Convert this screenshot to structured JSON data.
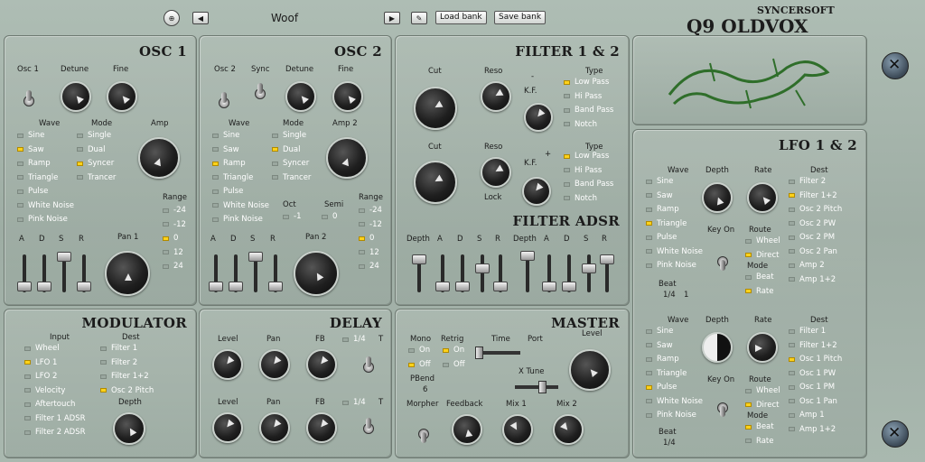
{
  "header": {
    "preset": "Woof",
    "load": "Load bank",
    "save": "Save bank",
    "brand": "SYNCERSOFT",
    "product": "Q9 OLDVOX"
  },
  "osc1": {
    "title": "OSC 1",
    "osc": "Osc 1",
    "detune": "Detune",
    "fine": "Fine",
    "wave": "Wave",
    "mode": "Mode",
    "amp": "Amp",
    "waves": [
      "Sine",
      "Saw",
      "Ramp",
      "Triangle",
      "Pulse",
      "White Noise",
      "Pink Noise"
    ],
    "wave_on": 1,
    "modes": [
      "Single",
      "Dual",
      "Syncer",
      "Trancer"
    ],
    "mode_on": 2,
    "range": "Range",
    "ranges": [
      "-24",
      "-12",
      "0",
      "12",
      "24"
    ],
    "range_on": 2,
    "adsr": [
      "A",
      "D",
      "S",
      "R"
    ],
    "pan": "Pan 1"
  },
  "osc2": {
    "title": "OSC 2",
    "osc": "Osc 2",
    "sync": "Sync",
    "detune": "Detune",
    "fine": "Fine",
    "wave": "Wave",
    "mode": "Mode",
    "amp": "Amp 2",
    "waves": [
      "Sine",
      "Saw",
      "Ramp",
      "Triangle",
      "Pulse",
      "White Noise",
      "Pink Noise"
    ],
    "wave_on": 2,
    "modes": [
      "Single",
      "Dual",
      "Syncer",
      "Trancer"
    ],
    "mode_on": 1,
    "oct": "Oct",
    "semi": "Semi",
    "oct_val": "-1",
    "semi_val": "0",
    "range": "Range",
    "ranges": [
      "-24",
      "-12",
      "0",
      "12",
      "24"
    ],
    "range_on": 2,
    "adsr": [
      "A",
      "D",
      "S",
      "R"
    ],
    "pan": "Pan 2"
  },
  "filter": {
    "title": "FILTER 1 & 2",
    "cut": "Cut",
    "reso": "Reso",
    "kf": "K.F.",
    "type": "Type",
    "minus": "-",
    "plus": "+",
    "lock": "Lock",
    "types": [
      "Low Pass",
      "Hi Pass",
      "Band Pass",
      "Notch"
    ],
    "type1_on": 0,
    "type2_on": 0,
    "adsr_title": "FILTER ADSR",
    "depth": "Depth",
    "adsr": [
      "A",
      "D",
      "S",
      "R"
    ]
  },
  "lfo": {
    "title": "LFO 1 & 2",
    "wave": "Wave",
    "depth": "Depth",
    "rate": "Rate",
    "dest": "Dest",
    "keyon": "Key On",
    "route": "Route",
    "mode": "Mode",
    "beat": "Beat",
    "waves": [
      "Sine",
      "Saw",
      "Ramp",
      "Triangle",
      "Pulse",
      "White Noise",
      "Pink Noise"
    ],
    "wave1_on": 3,
    "wave2_on": 4,
    "dests": [
      "Filter 2",
      "Filter 1+2",
      "Osc 2 Pitch",
      "Osc 2 PW",
      "Osc 2 PM",
      "Osc 2 Pan",
      "Amp 2",
      "Amp 1+2"
    ],
    "dest1_on": 1,
    "dests2": [
      "Filter 1",
      "Filter 1+2",
      "Osc 1 Pitch",
      "Osc 1 PW",
      "Osc 1 PM",
      "Osc 1 Pan",
      "Amp 1",
      "Amp 1+2"
    ],
    "dest2_on": 2,
    "routes": [
      "Wheel",
      "Direct"
    ],
    "modes": [
      "Beat",
      "Rate"
    ],
    "beat1": "1/4",
    "beat1n": "1",
    "beat2": "1/4"
  },
  "mod": {
    "title": "MODULATOR",
    "input": "Input",
    "dest": "Dest",
    "depth": "Depth",
    "inputs": [
      "Wheel",
      "LFO 1",
      "LFO 2",
      "Velocity",
      "Aftertouch",
      "Filter 1 ADSR",
      "Filter 2 ADSR"
    ],
    "input_on": 1,
    "dests": [
      "Filter 1",
      "Filter 2",
      "Filter 1+2",
      "Osc 2 Pitch"
    ],
    "dest_on": 3
  },
  "delay": {
    "title": "DELAY",
    "level": "Level",
    "pan": "Pan",
    "fb": "FB",
    "div": "1/4",
    "t": "T"
  },
  "master": {
    "title": "MASTER",
    "mono": "Mono",
    "on": "On",
    "off": "Off",
    "retrig": "Retrig",
    "time": "Time",
    "port": "Port",
    "level": "Level",
    "pbend": "PBend",
    "pbend_val": "6",
    "xtune": "X Tune",
    "morpher": "Morpher",
    "feedback": "Feedback",
    "mix1": "Mix 1",
    "mix2": "Mix 2"
  }
}
